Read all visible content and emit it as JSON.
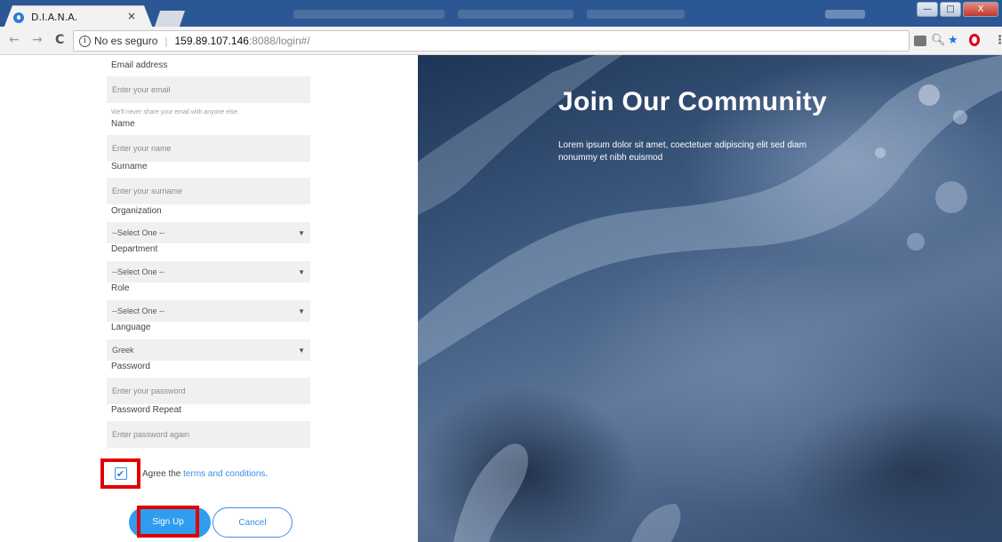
{
  "browser": {
    "tab_title": "D.I.A.N.A.",
    "tab_close": "×",
    "security_label": "No es seguro",
    "url_host": "159.89.107.146",
    "url_path": ":8088/login#/",
    "back_glyph": "←",
    "forward_glyph": "→",
    "reload_glyph": "C",
    "info_glyph": "i",
    "window_buttons": {
      "minimize": "—",
      "maximize": "□",
      "close": "X"
    },
    "toolbar_icons": [
      "translate-icon",
      "zoom-icon",
      "star-icon",
      "opera-icon",
      "menu-icon"
    ],
    "bookmark_color": "#1a73e8",
    "opera_color": "#e0001b"
  },
  "form": {
    "email": {
      "label": "Email address",
      "placeholder": "Enter your email",
      "help": "We'll never share your email with anyone else."
    },
    "name": {
      "label": "Name",
      "placeholder": "Enter your name"
    },
    "surname": {
      "label": "Surname",
      "placeholder": "Enter your surname"
    },
    "organization": {
      "label": "Organization",
      "value": "--Select One --"
    },
    "department": {
      "label": "Department",
      "value": "--Select One --"
    },
    "role": {
      "label": "Role",
      "value": "--Select One --"
    },
    "language": {
      "label": "Language",
      "value": "Greek"
    },
    "password": {
      "label": "Password",
      "placeholder": "Enter your password"
    },
    "password_repeat": {
      "label": "Password Repeat",
      "placeholder": "Enter password again"
    },
    "agree_prefix": "Agree the ",
    "terms_link": "terms and conditions",
    "agree_suffix": ".",
    "checkbox_checked": true,
    "signup_label": "Sign Up",
    "cancel_label": "Cancel",
    "accent_color": "#2f9cf0",
    "highlight_color": "#e00000"
  },
  "hero": {
    "title": "Join Our Community",
    "subtitle": "Lorem ipsum dolor sit amet, coectetuer adipiscing elit sed diam nonummy et nibh euismod"
  }
}
